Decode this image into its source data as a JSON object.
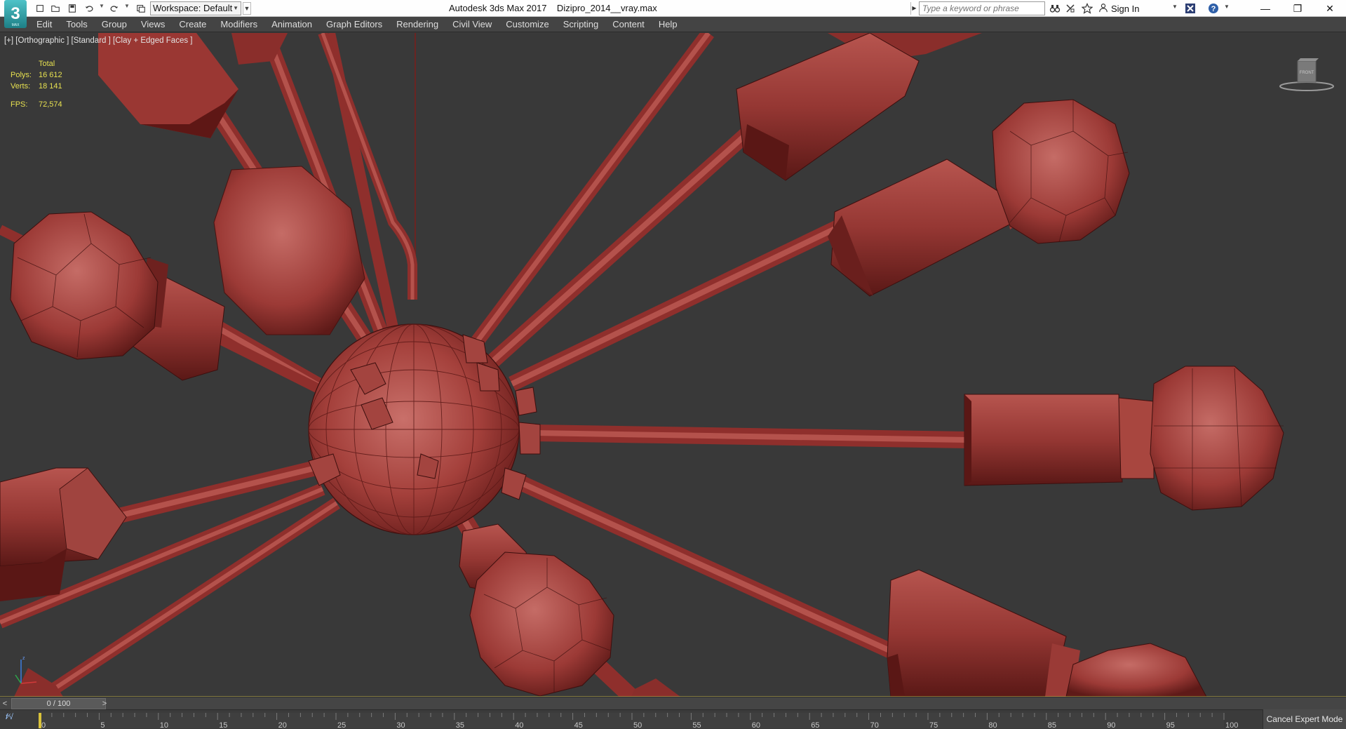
{
  "app": {
    "window_title": "Autodesk 3ds Max 2017    Dizipro_2014__vray.max",
    "logo_text": "3"
  },
  "quick_access": {
    "icons": [
      "new-file-icon",
      "open-file-icon",
      "save-icon",
      "undo-icon",
      "redo-icon",
      "project-folder-icon"
    ],
    "workspace_label": "Workspace: Default"
  },
  "search": {
    "placeholder": "Type a keyword or phrase"
  },
  "infocenter": {
    "icons": [
      "binoculars-icon",
      "subscription-icon",
      "star-icon",
      "user-icon",
      "exchange-icon",
      "help-icon"
    ],
    "sign_in_label": "Sign In"
  },
  "window_controls": {
    "minimize": "—",
    "restore": "❐",
    "close": "✕"
  },
  "menu": {
    "items": [
      "Edit",
      "Tools",
      "Group",
      "Views",
      "Create",
      "Modifiers",
      "Animation",
      "Graph Editors",
      "Rendering",
      "Civil View",
      "Customize",
      "Scripting",
      "Content",
      "Help"
    ]
  },
  "viewport": {
    "label": "[+] [Orthographic ] [Standard ] [Clay + Edged Faces ]",
    "stats": {
      "header": "Total",
      "polys_label": "Polys:",
      "polys_value": "16 612",
      "verts_label": "Verts:",
      "verts_value": "18 141",
      "fps_label": "FPS:",
      "fps_value": "72,574"
    },
    "viewcube_label": "FRONT",
    "model_color": "#a0413d",
    "background_color": "#393939"
  },
  "time_slider": {
    "prev": "<",
    "position_label": "0 / 100",
    "next": ">",
    "current_frame": 0,
    "total_frames": 100
  },
  "track_bar": {
    "ticks": [
      "0",
      "5",
      "10",
      "15",
      "20",
      "25",
      "30",
      "35",
      "40",
      "45",
      "50",
      "55",
      "60",
      "65",
      "70",
      "75",
      "80",
      "85",
      "90",
      "95",
      "100"
    ],
    "mini_curve_label": "f∕√"
  },
  "status": {
    "cancel_expert_label": "Cancel Expert Mode"
  }
}
